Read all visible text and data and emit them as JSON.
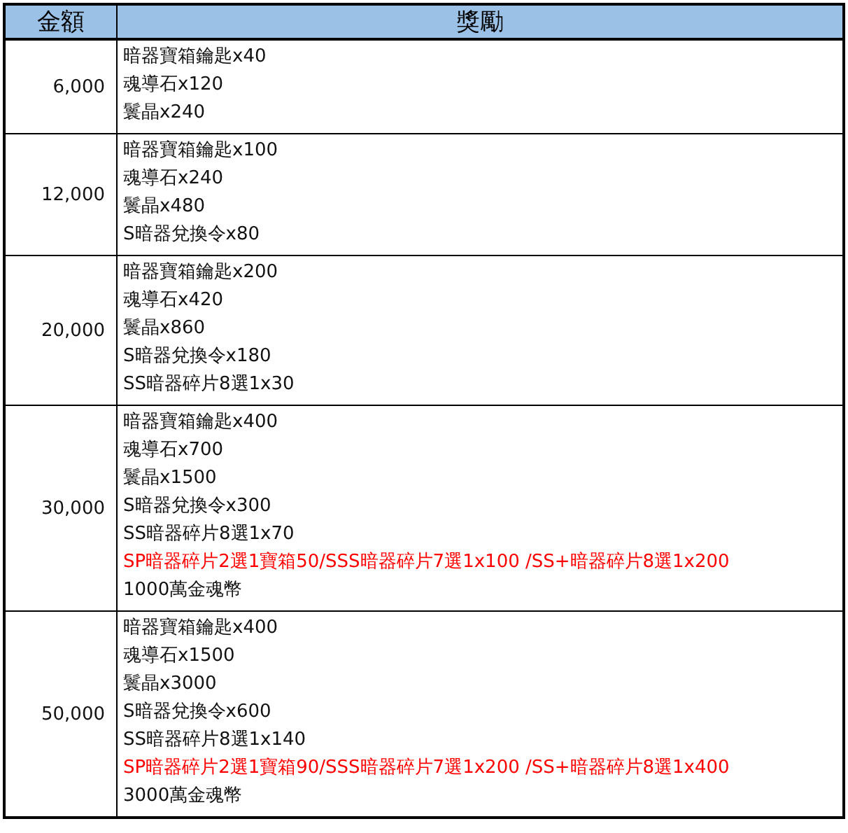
{
  "table": {
    "columns": [
      "金額",
      "獎勵"
    ],
    "rows": [
      {
        "amount": "6,000",
        "rewards": [
          {
            "text": "暗器寶箱鑰匙x40",
            "kind": "normal"
          },
          {
            "text": "魂導石x120",
            "kind": "normal"
          },
          {
            "text": "鬟晶x240",
            "kind": "normal"
          }
        ]
      },
      {
        "amount": "12,000",
        "rewards": [
          {
            "text": "暗器寶箱鑰匙x100",
            "kind": "normal"
          },
          {
            "text": "魂導石x240",
            "kind": "normal"
          },
          {
            "text": "鬟晶x480",
            "kind": "normal"
          },
          {
            "text": "S暗器兌換令x80",
            "kind": "normal"
          }
        ]
      },
      {
        "amount": "20,000",
        "rewards": [
          {
            "text": "暗器寶箱鑰匙x200",
            "kind": "normal"
          },
          {
            "text": "魂導石x420",
            "kind": "normal"
          },
          {
            "text": "鬟晶x860",
            "kind": "normal"
          },
          {
            "text": "S暗器兌換令x180",
            "kind": "normal"
          },
          {
            "text": "SS暗器碎片8選1x30",
            "kind": "normal"
          }
        ]
      },
      {
        "amount": "30,000",
        "rewards": [
          {
            "text": "暗器寶箱鑰匙x400",
            "kind": "normal"
          },
          {
            "text": "魂導石x700",
            "kind": "normal"
          },
          {
            "text": "鬟晶x1500",
            "kind": "normal"
          },
          {
            "text": "S暗器兌換令x300",
            "kind": "normal"
          },
          {
            "text": "SS暗器碎片8選1x70",
            "kind": "normal"
          },
          {
            "text": "SP暗器碎片2選1寶箱50/SSS暗器碎片7選1x100 /SS+暗器碎片8選1x200",
            "kind": "highlight"
          },
          {
            "text": "1000萬金魂幣",
            "kind": "normal"
          }
        ]
      },
      {
        "amount": "50,000",
        "rewards": [
          {
            "text": "暗器寶箱鑰匙x400",
            "kind": "normal"
          },
          {
            "text": "魂導石x1500",
            "kind": "normal"
          },
          {
            "text": "鬟晶x3000",
            "kind": "normal"
          },
          {
            "text": "S暗器兌換令x600",
            "kind": "normal"
          },
          {
            "text": "SS暗器碎片8選1x140",
            "kind": "normal"
          },
          {
            "text": "SP暗器碎片2選1寶箱90/SSS暗器碎片7選1x200 /SS+暗器碎片8選1x400",
            "kind": "highlight"
          },
          {
            "text": "3000萬金魂幣",
            "kind": "normal"
          }
        ]
      }
    ]
  }
}
